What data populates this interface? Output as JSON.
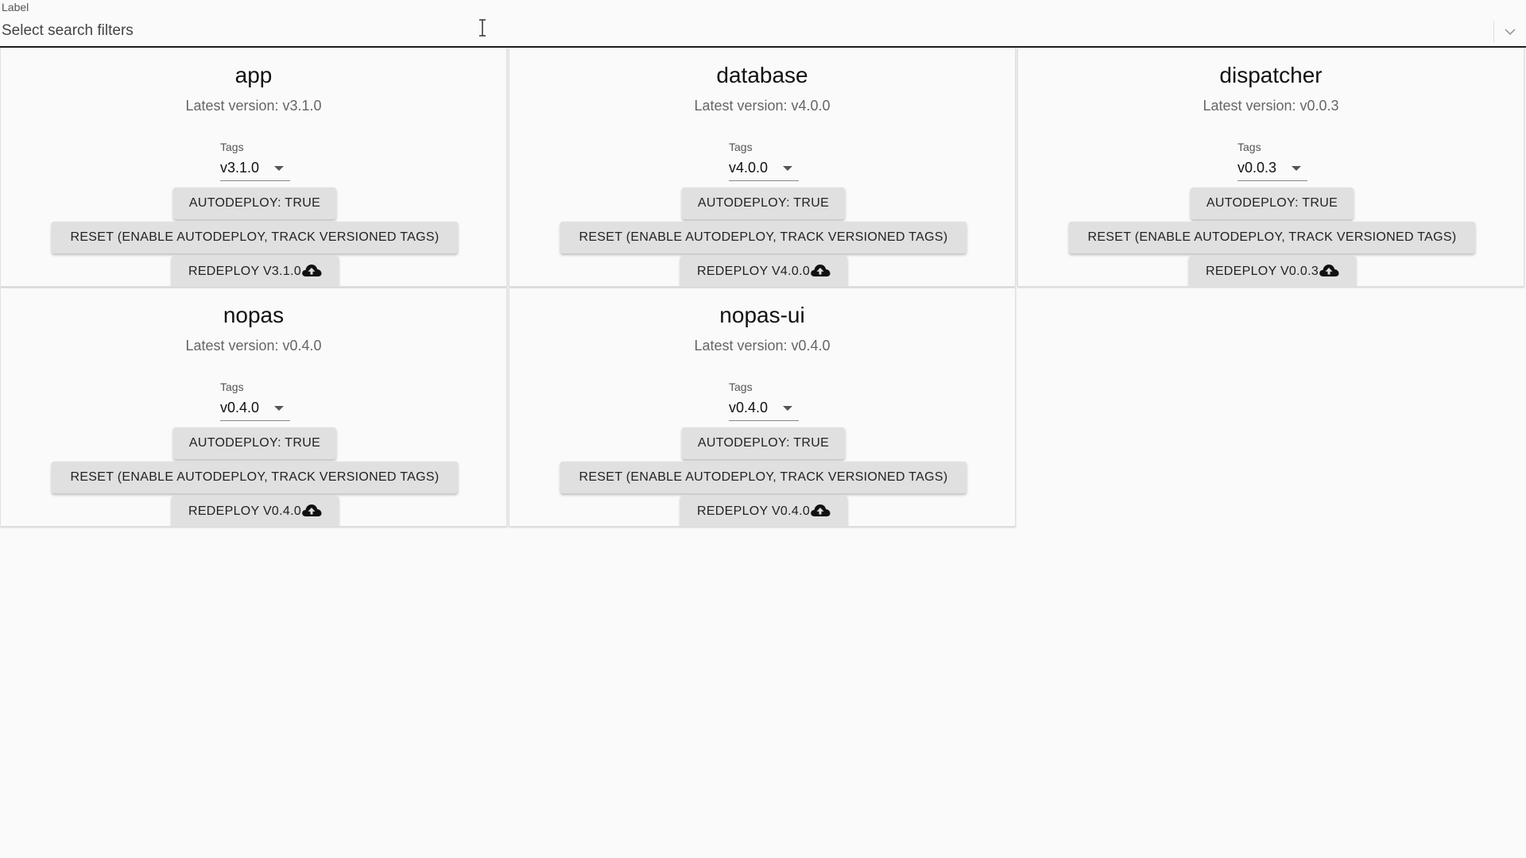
{
  "filter": {
    "label": "Label",
    "placeholder": "Select search filters",
    "value": ""
  },
  "cards": [
    {
      "name": "app",
      "latest": "Latest version: v3.1.0",
      "tags_label": "Tags",
      "tag_value": "v3.1.0",
      "autodeploy_label": "AUTODEPLOY: TRUE",
      "reset_label": "RESET (ENABLE AUTODEPLOY, TRACK VERSIONED TAGS)",
      "redeploy_label": "REDEPLOY V3.1.0"
    },
    {
      "name": "database",
      "latest": "Latest version: v4.0.0",
      "tags_label": "Tags",
      "tag_value": "v4.0.0",
      "autodeploy_label": "AUTODEPLOY: TRUE",
      "reset_label": "RESET (ENABLE AUTODEPLOY, TRACK VERSIONED TAGS)",
      "redeploy_label": "REDEPLOY V4.0.0"
    },
    {
      "name": "dispatcher",
      "latest": "Latest version: v0.0.3",
      "tags_label": "Tags",
      "tag_value": "v0.0.3",
      "autodeploy_label": "AUTODEPLOY: TRUE",
      "reset_label": "RESET (ENABLE AUTODEPLOY, TRACK VERSIONED TAGS)",
      "redeploy_label": "REDEPLOY V0.0.3"
    },
    {
      "name": "nopas",
      "latest": "Latest version: v0.4.0",
      "tags_label": "Tags",
      "tag_value": "v0.4.0",
      "autodeploy_label": "AUTODEPLOY: TRUE",
      "reset_label": "RESET (ENABLE AUTODEPLOY, TRACK VERSIONED TAGS)",
      "redeploy_label": "REDEPLOY V0.4.0"
    },
    {
      "name": "nopas-ui",
      "latest": "Latest version: v0.4.0",
      "tags_label": "Tags",
      "tag_value": "v0.4.0",
      "autodeploy_label": "AUTODEPLOY: TRUE",
      "reset_label": "RESET (ENABLE AUTODEPLOY, TRACK VERSIONED TAGS)",
      "redeploy_label": "REDEPLOY V0.4.0"
    }
  ],
  "icons": {
    "filter_dropdown": "chevron-down-icon",
    "tag_dropdown": "caret-down-icon",
    "redeploy": "cloud-upload-icon",
    "mouse": "text-cursor-icon"
  },
  "colors": {
    "background": "#fafafa",
    "button": "#e0e0e0",
    "text": "#212121"
  }
}
